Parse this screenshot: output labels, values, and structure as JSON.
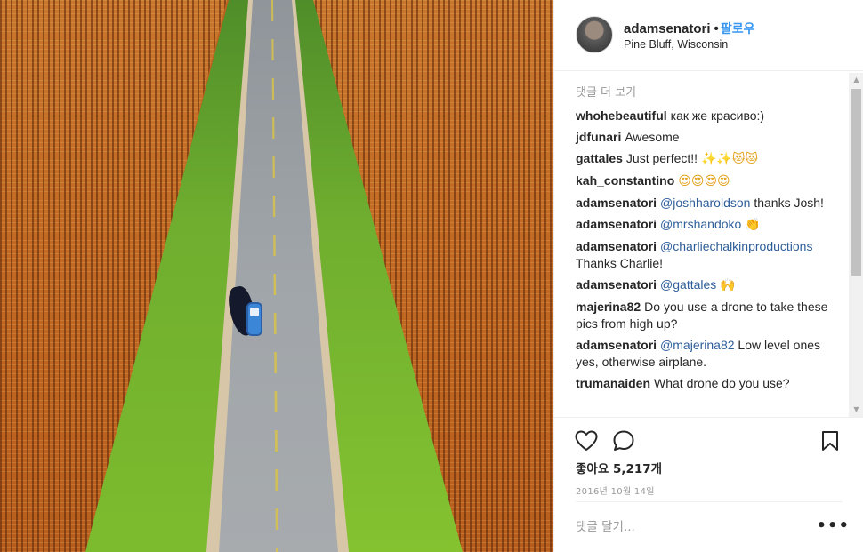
{
  "post": {
    "username": "adamsenatori",
    "separator": "•",
    "follow_label": "팔로우",
    "location": "Pine Bluff, Wisconsin"
  },
  "comments": {
    "view_more": "댓글 더 보기",
    "items": [
      {
        "user": "whohebeautiful",
        "text": "как же красиво:)",
        "mention": "",
        "tail": "",
        "emoji": ""
      },
      {
        "user": "jdfunari",
        "text": "Awesome",
        "mention": "",
        "tail": "",
        "emoji": ""
      },
      {
        "user": "gattales",
        "text": "Just perfect!!",
        "mention": "",
        "tail": "",
        "emoji": "✨✨😻😻"
      },
      {
        "user": "kah_constantino",
        "text": "",
        "mention": "",
        "tail": "",
        "emoji": "😍😍😍😍"
      },
      {
        "user": "adamsenatori",
        "text": "",
        "mention": "@joshharoldson",
        "tail": "thanks Josh!",
        "emoji": ""
      },
      {
        "user": "adamsenatori",
        "text": "",
        "mention": "@mrshandoko",
        "tail": "",
        "emoji": "👏"
      },
      {
        "user": "adamsenatori",
        "text": "",
        "mention": "@charliechalkinproductions",
        "tail": "Thanks Charlie!",
        "emoji": ""
      },
      {
        "user": "adamsenatori",
        "text": "",
        "mention": "@gattales",
        "tail": "",
        "emoji": "🙌"
      },
      {
        "user": "majerina82",
        "text": "Do you use a drone to take these pics from high up?",
        "mention": "",
        "tail": "",
        "emoji": ""
      },
      {
        "user": "adamsenatori",
        "text": "",
        "mention": "@majerina82",
        "tail": "Low level ones yes, otherwise airplane.",
        "emoji": ""
      },
      {
        "user": "trumanaiden",
        "text": "What drone do you use?",
        "mention": "",
        "tail": "",
        "emoji": ""
      }
    ]
  },
  "actions": {
    "like_icon": "heart-outline-icon",
    "comment_icon": "speech-bubble-icon",
    "save_icon": "bookmark-icon",
    "likes_text": "좋아요 5,217개",
    "date": "2016년 10월 14일"
  },
  "add_comment": {
    "placeholder": "댓글 달기...",
    "more_label": "•••"
  },
  "colors": {
    "link": "#3897f0",
    "mention": "#2e5e9a",
    "muted": "#999999",
    "text": "#262626"
  }
}
